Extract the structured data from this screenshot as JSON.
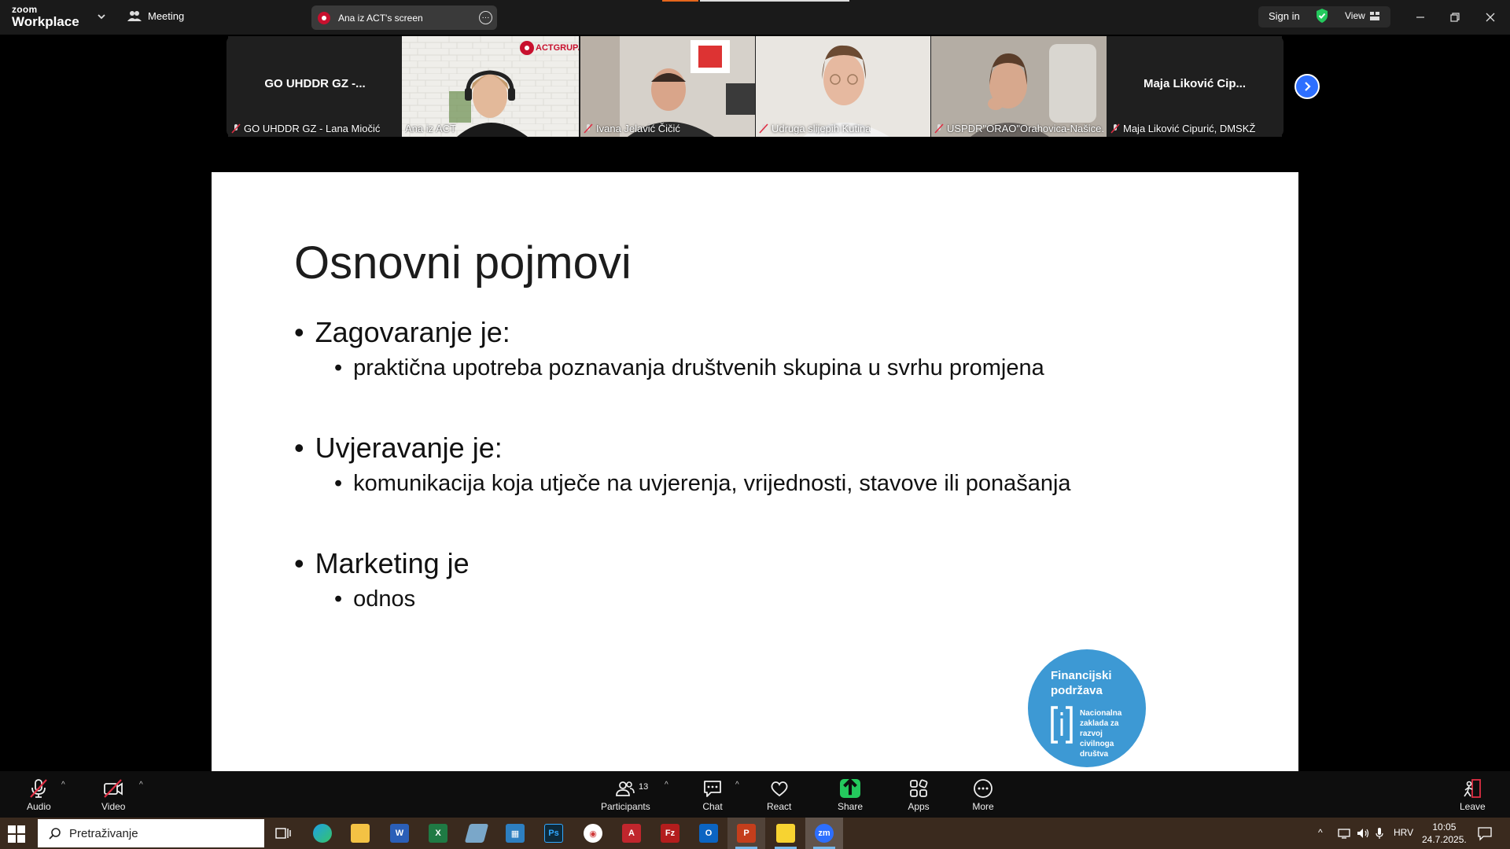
{
  "app": {
    "brand_small": "zoom",
    "brand_large": "Workplace",
    "meeting_label": "Meeting",
    "screen_share_label": "Ana iz ACT's screen",
    "sign_in": "Sign in",
    "view_label": "View"
  },
  "participants": [
    {
      "name_large": "GO UHDDR GZ -...",
      "label": "GO UHDDR GZ - Lana Miočić",
      "has_video": false
    },
    {
      "label": "Ana iz ACT",
      "has_video": true,
      "active_speaker": true,
      "sign_text": "ACTGRUPA"
    },
    {
      "label": "Ivana Jelavić Čičić",
      "has_video": true
    },
    {
      "label": "Udruga slijepih Kutina",
      "has_video": true
    },
    {
      "label": "USPDR\"ORAO\"Orahovica-Našice...",
      "has_video": true
    },
    {
      "name_large": "Maja  Liković  Cip...",
      "label": "Maja Liković Cipurić, DMSKŽ",
      "has_video": false
    }
  ],
  "slide": {
    "title": "Osnovni pojmovi",
    "sections": [
      {
        "heading": "Zagovaranje je:",
        "sub": "praktična upotreba poznavanja društvenih skupina u svrhu promjena"
      },
      {
        "heading": "Uvjeravanje je:",
        "sub": "komunikacija koja utječe na uvjerenja, vrijednosti, stavove ili ponašanja"
      },
      {
        "heading": "Marketing je",
        "sub": "odnos"
      }
    ],
    "bullet_char": "•",
    "logo": {
      "line1": "Financijski",
      "line2": "podržava",
      "org_lines": [
        "Nacionalna",
        "zaklada za",
        "razvoj",
        "civilnoga",
        "društva"
      ]
    }
  },
  "controls": {
    "audio": "Audio",
    "video": "Video",
    "participants": "Participants",
    "participants_count": "13",
    "chat": "Chat",
    "react": "React",
    "share": "Share",
    "apps": "Apps",
    "more": "More",
    "leave": "Leave"
  },
  "taskbar": {
    "search_placeholder": "Pretraživanje",
    "language": "HRV",
    "time": "10:05",
    "date": "24.7.2025."
  },
  "colors": {
    "accent_green": "#3ec36a",
    "share_green": "#24c95d",
    "logo_blue": "#3d99d4",
    "mute_red": "#e02f44",
    "next_blue": "#2d6fff"
  }
}
